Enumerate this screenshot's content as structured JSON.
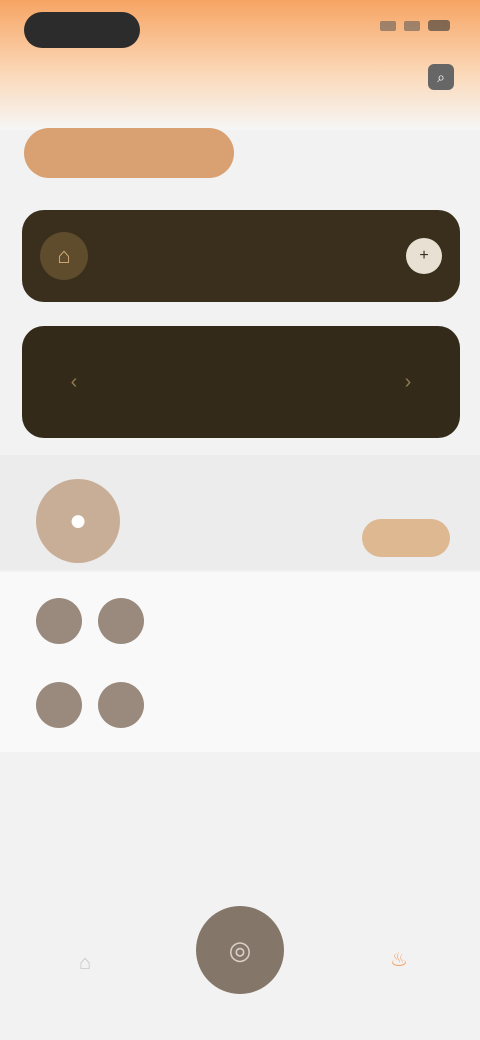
{
  "status": {
    "time": ""
  },
  "header": {
    "title": "",
    "action_icon": "search-icon"
  },
  "chip": {
    "label": ""
  },
  "cards": {
    "primary": {
      "title": "",
      "subtitle": "",
      "left_icon": "bell-icon",
      "right_icon": "plus-icon"
    },
    "secondary": {
      "title": "",
      "left_icon": "chevron-left-icon",
      "right_icon": "chevron-right-icon"
    }
  },
  "profile": {
    "name": "",
    "button_label": "",
    "avatar_icon": "user-icon"
  },
  "list": {
    "items": [
      {
        "title": "",
        "subtitle": "",
        "meta": ""
      },
      {
        "title": "",
        "subtitle": "",
        "meta": ""
      }
    ]
  },
  "nav": {
    "left_icon": "home-icon",
    "center_icon": "camera-icon",
    "right_icon": "flame-icon"
  },
  "colors": {
    "accent": "#f6a463",
    "card_dark": "#3a2f1d",
    "card_dark2": "#332a1a",
    "fab": "#847668"
  }
}
